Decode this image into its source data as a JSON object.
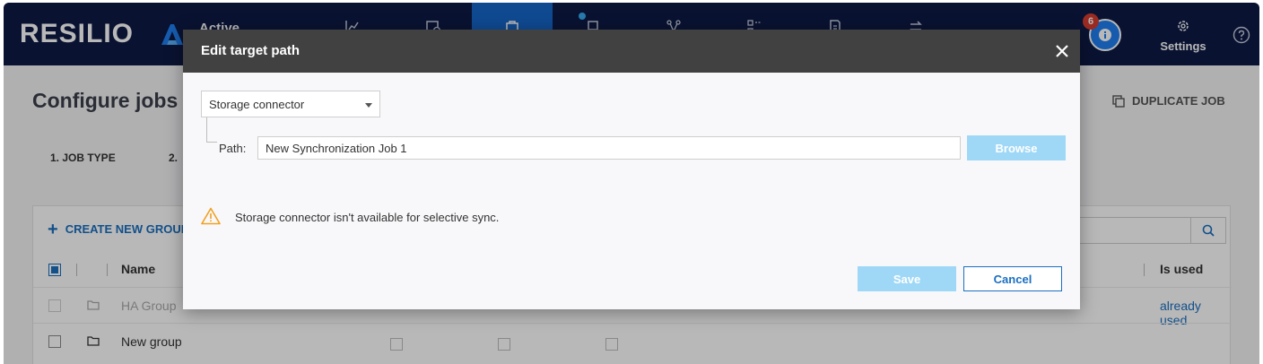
{
  "app": {
    "logo_text": "RESILIO",
    "product_label": "Active"
  },
  "topbar": {
    "nav_icons": [
      "dashboard-chart-icon",
      "schedule-icon",
      "jobs-icon",
      "agents-icon",
      "nodes-icon",
      "groups-icon",
      "reports-icon",
      "transfers-icon"
    ],
    "active_index": 2,
    "notifications_count": "6",
    "settings_label": "Settings"
  },
  "page": {
    "title": "Configure jobs >",
    "duplicate_label": "DUPLICATE JOB",
    "steps": [
      "1. JOB TYPE",
      "2."
    ],
    "create_group_label": "CREATE NEW GROUP",
    "columns": {
      "name": "Name",
      "is_used": "Is used"
    },
    "rows": [
      {
        "name": "HA Group",
        "is_used": "already used",
        "disabled": true
      },
      {
        "name": "New group",
        "is_used": "",
        "disabled": false
      }
    ]
  },
  "modal": {
    "title": "Edit target path",
    "connector_select": "Storage connector",
    "path_label": "Path:",
    "path_value": "New Synchronization Job 1",
    "browse_label": "Browse",
    "warning_text": "Storage connector isn't available for selective sync.",
    "save_label": "Save",
    "cancel_label": "Cancel"
  },
  "colors": {
    "topbar_bg": "#0d1a44",
    "nav_active": "#1566c8",
    "accent": "#1a6fc0",
    "disabled_button": "#9fd8f7",
    "warning": "#f0a020",
    "badge": "#d63c30"
  }
}
